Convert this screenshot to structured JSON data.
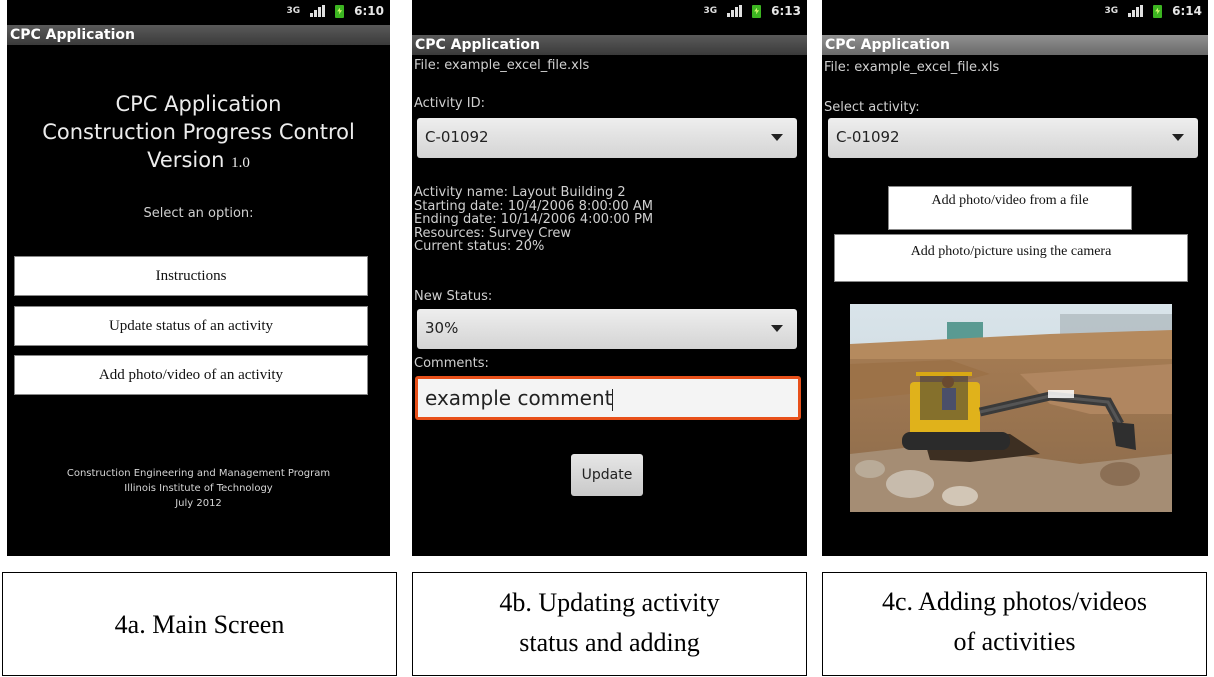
{
  "screens": {
    "main": {
      "time": "6:10",
      "network": "3G",
      "app_title": "CPC Application",
      "heading_line1": "CPC Application",
      "heading_line2": "Construction Progress Control",
      "heading_line3_prefix": "Version",
      "version_number": "1.0",
      "select_prompt": "Select an option:",
      "buttons": [
        "Instructions",
        "Update status of an activity",
        "Add photo/video of an activity"
      ],
      "footer_line1": "Construction Engineering and Management Program",
      "footer_line2": "Illinois Institute of Technology",
      "footer_line3": "July 2012"
    },
    "update": {
      "time": "6:13",
      "network": "3G",
      "app_title": "CPC Application",
      "file_label": "File: example_excel_file.xls",
      "activity_id_label": "Activity ID:",
      "activity_id_value": "C-01092",
      "activity_name": "Activity name: Layout Building 2",
      "starting_date": "Starting date: 10/4/2006 8:00:00 AM",
      "ending_date": "Ending date: 10/14/2006 4:00:00 PM",
      "resources": "Resources: Survey Crew",
      "current_status": "Current status: 20%",
      "new_status_label": "New Status:",
      "new_status_value": "30%",
      "comments_label": "Comments:",
      "comments_value": "example comment",
      "update_button": "Update"
    },
    "photo": {
      "time": "6:14",
      "network": "3G",
      "app_title": "CPC Application",
      "file_label": "File: example_excel_file.xls",
      "select_activity_label": "Select activity:",
      "activity_value": "C-01092",
      "add_from_file_button": "Add photo/video from a file",
      "add_from_camera_button": "Add photo/picture using the camera"
    }
  },
  "captions": {
    "a": "4a. Main Screen",
    "b_line1": "4b. Updating activity",
    "b_line2": "status and adding",
    "c_line1": "4c. Adding photos/videos",
    "c_line2": "of activities"
  },
  "colors": {
    "phone_bg": "#000000",
    "titlebar": "#4a4a4a",
    "battery": "#3cb521",
    "comment_focus": "#e8501a"
  }
}
